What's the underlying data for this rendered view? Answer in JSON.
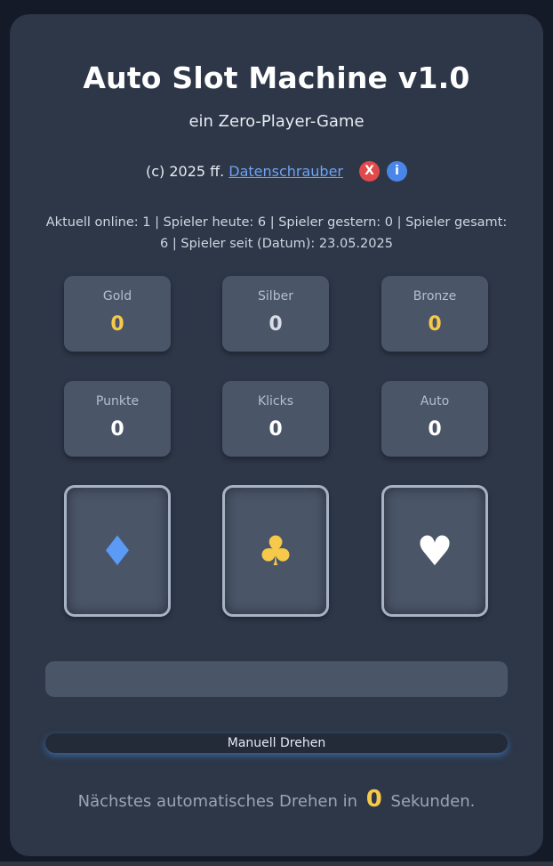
{
  "header": {
    "title": "Auto Slot Machine v1.0",
    "subtitle": "ein Zero-Player-Game",
    "copyright_prefix": "(c) 2025 ff.",
    "author_link": "Datenschrauber",
    "close_icon_label": "X",
    "info_icon_label": "i"
  },
  "online_stats": {
    "text": "Aktuell online: 1 | Spieler heute: 6 | Spieler gestern: 0 | Spieler gesamt: 6 | Spieler seit (Datum): 23.05.2025"
  },
  "medals": [
    {
      "label": "Gold",
      "value": "0",
      "color": "#f6c94a"
    },
    {
      "label": "Silber",
      "value": "0",
      "color": "#d7dde6"
    },
    {
      "label": "Bronze",
      "value": "0",
      "color": "#f6c94a"
    }
  ],
  "counters": [
    {
      "label": "Punkte",
      "value": "0"
    },
    {
      "label": "Klicks",
      "value": "0"
    },
    {
      "label": "Auto",
      "value": "0"
    }
  ],
  "reels": [
    {
      "symbol": "♦",
      "icon": "diamond-icon",
      "color": "#5b9bf5"
    },
    {
      "symbol": "♣",
      "icon": "club-icon",
      "color": "#f6c94a"
    },
    {
      "symbol": "♥",
      "icon": "heart-icon",
      "color": "#ffffff"
    }
  ],
  "message": "",
  "spin_button_label": "Manuell Drehen",
  "next_spin": {
    "prefix": "Nächstes automatisches Drehen in",
    "seconds": "0",
    "suffix": "Sekunden."
  }
}
